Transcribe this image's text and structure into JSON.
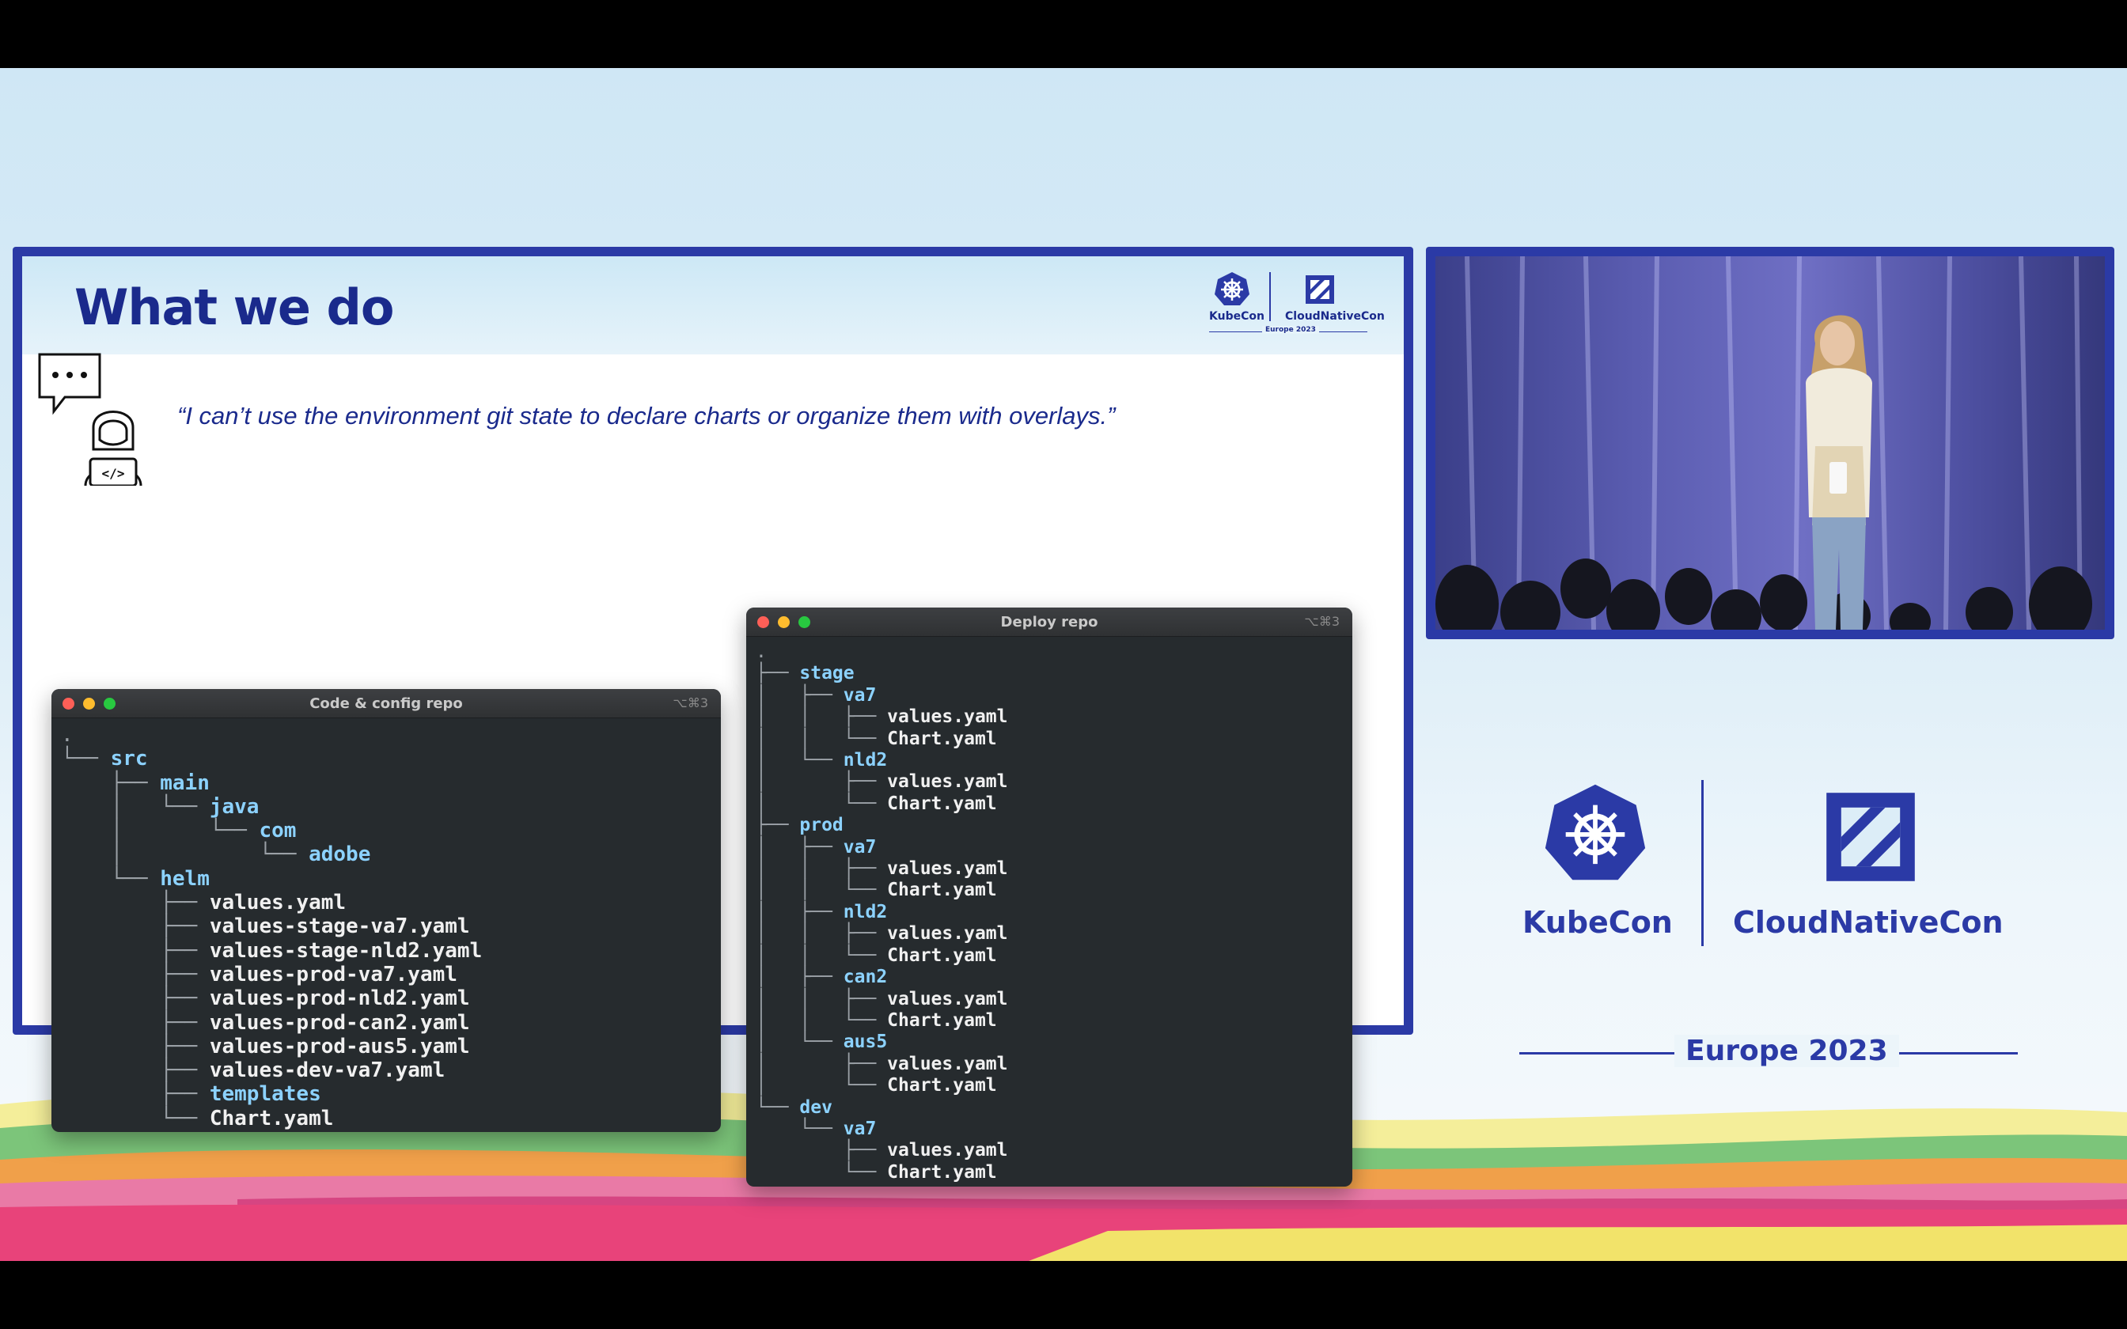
{
  "slide": {
    "title": "What we do",
    "quote": "“I can’t use the environment git state to declare charts or organize them with overlays.”",
    "logo": {
      "left": "KubeCon",
      "right": "CloudNativeCon",
      "sub": "Europe 2023"
    },
    "code_terminal": {
      "title": "Code & config repo",
      "shortcut": "⌥⌘3",
      "lines": [
        {
          "prefix": ".",
          "name": "",
          "kind": "root"
        },
        {
          "prefix": "└── ",
          "name": "src",
          "kind": "dir"
        },
        {
          "prefix": "    ├── ",
          "name": "main",
          "kind": "dir"
        },
        {
          "prefix": "    │   └── ",
          "name": "java",
          "kind": "dir"
        },
        {
          "prefix": "    │       └── ",
          "name": "com",
          "kind": "dir"
        },
        {
          "prefix": "    │           └── ",
          "name": "adobe",
          "kind": "dir"
        },
        {
          "prefix": "    └── ",
          "name": "helm",
          "kind": "dir"
        },
        {
          "prefix": "        ├── ",
          "name": "values.yaml",
          "kind": "file"
        },
        {
          "prefix": "        ├── ",
          "name": "values-stage-va7.yaml",
          "kind": "file"
        },
        {
          "prefix": "        ├── ",
          "name": "values-stage-nld2.yaml",
          "kind": "file"
        },
        {
          "prefix": "        ├── ",
          "name": "values-prod-va7.yaml",
          "kind": "file"
        },
        {
          "prefix": "        ├── ",
          "name": "values-prod-nld2.yaml",
          "kind": "file"
        },
        {
          "prefix": "        ├── ",
          "name": "values-prod-can2.yaml",
          "kind": "file"
        },
        {
          "prefix": "        ├── ",
          "name": "values-prod-aus5.yaml",
          "kind": "file"
        },
        {
          "prefix": "        ├── ",
          "name": "values-dev-va7.yaml",
          "kind": "file"
        },
        {
          "prefix": "        ├── ",
          "name": "templates",
          "kind": "dir"
        },
        {
          "prefix": "        └── ",
          "name": "Chart.yaml",
          "kind": "file"
        }
      ]
    },
    "deploy_terminal": {
      "title": "Deploy repo",
      "shortcut": "⌥⌘3",
      "lines": [
        {
          "prefix": ".",
          "name": "",
          "kind": "root"
        },
        {
          "prefix": "├── ",
          "name": "stage",
          "kind": "dir"
        },
        {
          "prefix": "│   ├── ",
          "name": "va7",
          "kind": "dir"
        },
        {
          "prefix": "│   │   ├── ",
          "name": "values.yaml",
          "kind": "file"
        },
        {
          "prefix": "│   │   └── ",
          "name": "Chart.yaml",
          "kind": "file"
        },
        {
          "prefix": "│   └── ",
          "name": "nld2",
          "kind": "dir"
        },
        {
          "prefix": "│       ├── ",
          "name": "values.yaml",
          "kind": "file"
        },
        {
          "prefix": "│       └── ",
          "name": "Chart.yaml",
          "kind": "file"
        },
        {
          "prefix": "├── ",
          "name": "prod",
          "kind": "dir"
        },
        {
          "prefix": "│   ├── ",
          "name": "va7",
          "kind": "dir"
        },
        {
          "prefix": "│   │   ├── ",
          "name": "values.yaml",
          "kind": "file"
        },
        {
          "prefix": "│   │   └── ",
          "name": "Chart.yaml",
          "kind": "file"
        },
        {
          "prefix": "│   ├── ",
          "name": "nld2",
          "kind": "dir"
        },
        {
          "prefix": "│   │   ├── ",
          "name": "values.yaml",
          "kind": "file"
        },
        {
          "prefix": "│   │   └── ",
          "name": "Chart.yaml",
          "kind": "file"
        },
        {
          "prefix": "│   ├── ",
          "name": "can2",
          "kind": "dir"
        },
        {
          "prefix": "│   │   ├── ",
          "name": "values.yaml",
          "kind": "file"
        },
        {
          "prefix": "│   │   └── ",
          "name": "Chart.yaml",
          "kind": "file"
        },
        {
          "prefix": "│   └── ",
          "name": "aus5",
          "kind": "dir"
        },
        {
          "prefix": "│       ├── ",
          "name": "values.yaml",
          "kind": "file"
        },
        {
          "prefix": "│       └── ",
          "name": "Chart.yaml",
          "kind": "file"
        },
        {
          "prefix": "└── ",
          "name": "dev",
          "kind": "dir"
        },
        {
          "prefix": "    └── ",
          "name": "va7",
          "kind": "dir"
        },
        {
          "prefix": "        ├── ",
          "name": "values.yaml",
          "kind": "file"
        },
        {
          "prefix": "        └── ",
          "name": "Chart.yaml",
          "kind": "file"
        }
      ]
    }
  },
  "event_logo": {
    "left": "KubeCon",
    "right": "CloudNativeCon",
    "sub": "Europe 2023"
  },
  "icons": [
    "speech-bubble-icon",
    "developer-laptop-icon",
    "kubernetes-helm-icon",
    "cncf-icon"
  ],
  "colors": {
    "brand_blue": "#2b3aa6",
    "title_blue": "#1a2a8c",
    "terminal_bg": "#262b2e",
    "dir_color": "#8cd2ff"
  }
}
